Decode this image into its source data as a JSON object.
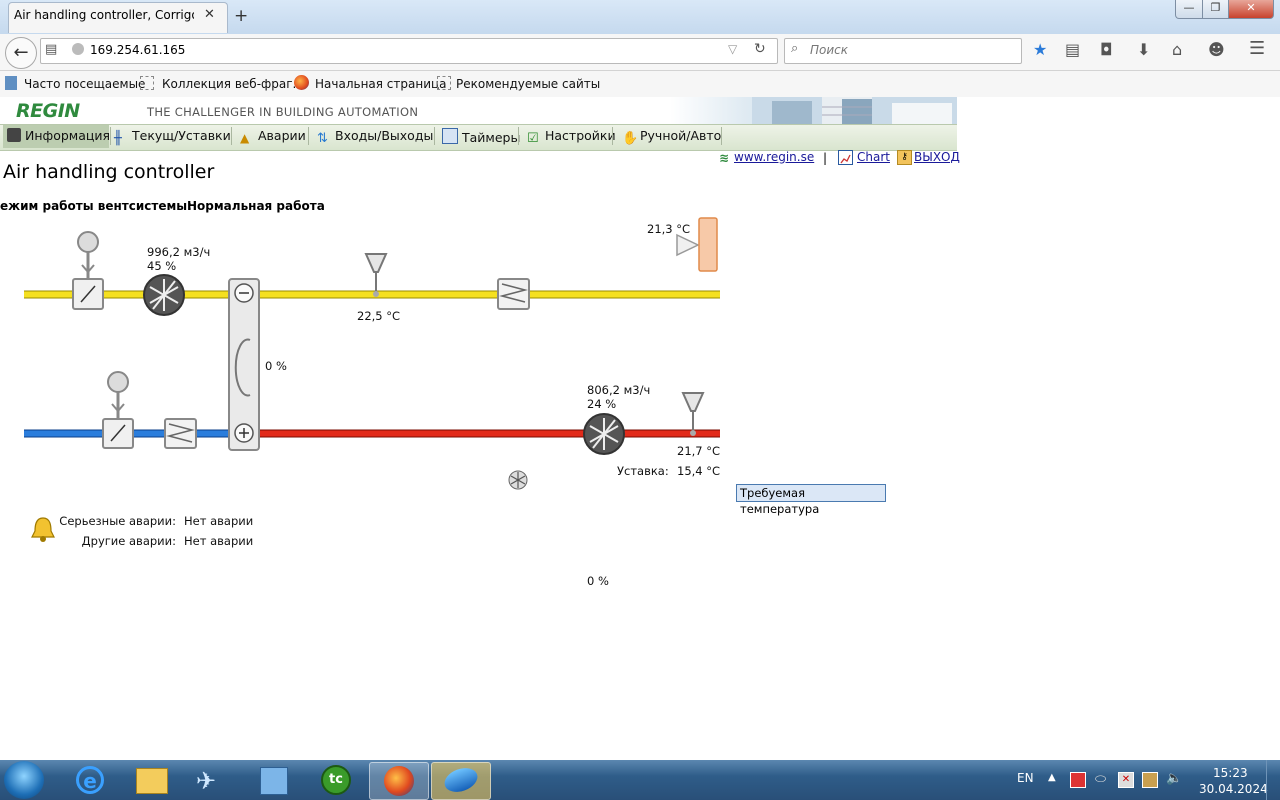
{
  "browser": {
    "tab_title": "Air handling controller, Corrigo E",
    "url": "169.254.61.165",
    "search_placeholder": "Поиск",
    "bookmarks": [
      "Часто посещаемые",
      "Коллекция веб-фраг...",
      "Начальная страница",
      "Рекомендуемые сайты"
    ]
  },
  "header": {
    "logo": "REGIN",
    "tagline": "THE CHALLENGER IN BUILDING AUTOMATION"
  },
  "menu": [
    "Информация",
    "Текущ/Уставки",
    "Аварии",
    "Входы/Выходы",
    "Таймеры",
    "Настройки",
    "Ручной/Авто"
  ],
  "links": {
    "website": "www.regin.se",
    "separator": "|",
    "chart": "Chart",
    "logout": "ВЫХОД"
  },
  "page": {
    "title": "Air handling controller",
    "mode_label": "ежим работы вентсистемы:",
    "mode_value": "Нормальная работа"
  },
  "diagram": {
    "supply_fan_flow": "996,2 м3/ч",
    "supply_fan_pct": "45 %",
    "supply_temp_sensor": "22,5 °C",
    "room_temp": "21,3 °C",
    "exchanger_pct": "0 %",
    "exhaust_fan_flow": "806,2 м3/ч",
    "exhaust_fan_pct": "24 %",
    "exhaust_temp": "21,7 °C",
    "setpoint_label": "Уставка:",
    "setpoint_value": "15,4 °C",
    "required_temp_tooltip": "Требуемая температура",
    "bottom_pct": "0 %"
  },
  "alarms": {
    "serious_label": "Серьезные аварии:",
    "serious_value": "Нет аварии",
    "other_label": "Другие аварии:",
    "other_value": "Нет аварии"
  },
  "taskbar": {
    "lang": "EN",
    "time": "15:23",
    "date": "30.04.2024"
  }
}
